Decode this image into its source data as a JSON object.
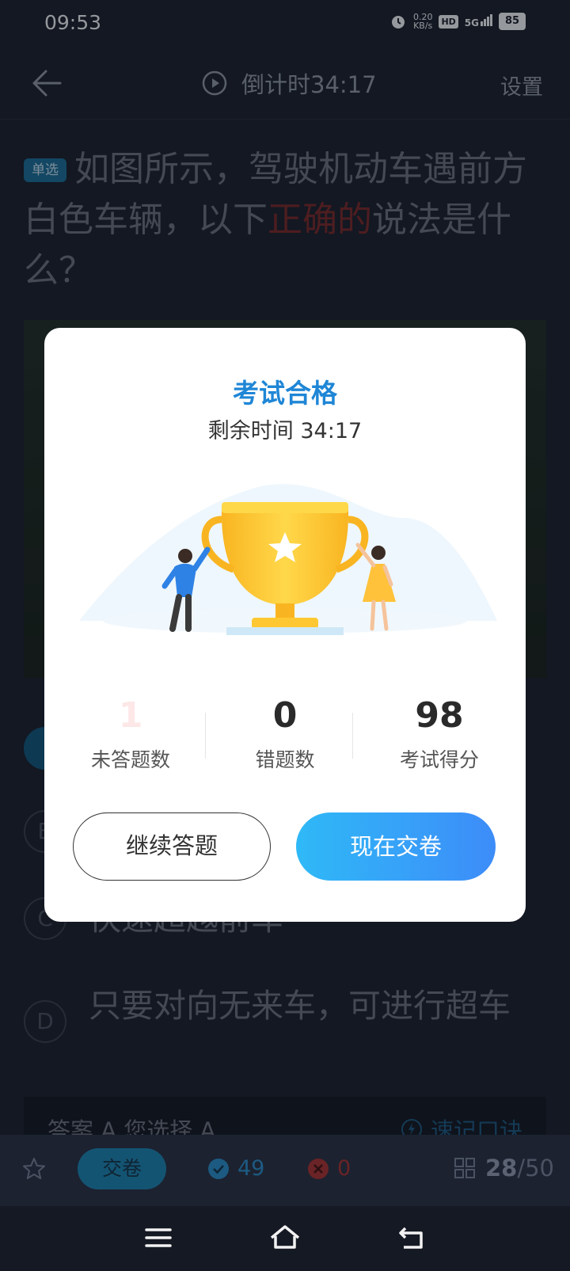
{
  "status_bar": {
    "time": "09:53",
    "speed_value": "0.20",
    "speed_unit": "KB/s",
    "hd": "HD",
    "network": "5G",
    "battery": "85"
  },
  "header": {
    "countdown": "倒计时34:17",
    "settings": "设置"
  },
  "question": {
    "type_tag": "单选",
    "text_before": "如图所示，驾驶机动车遇前方白色车辆，以下",
    "text_highlight": "正确的",
    "text_after": "说法是什么？"
  },
  "options": [
    {
      "letter": "B",
      "text": ""
    },
    {
      "letter": "C",
      "text": "快速超越前车"
    },
    {
      "letter": "D",
      "text": "只要对向无来车，可进行超车"
    }
  ],
  "answer_bar": {
    "answer_label": "答案",
    "answer_value": "A",
    "your_label": "您选择",
    "your_value": "A",
    "tip_label": "速记口诀"
  },
  "bottom_bar": {
    "submit": "交卷",
    "correct_count": "49",
    "wrong_count": "0",
    "current": "28",
    "total": "/50"
  },
  "modal": {
    "title": "考试合格",
    "remaining": "剩余时间 34:17",
    "stats": [
      {
        "value": "1",
        "label": "未答题数"
      },
      {
        "value": "0",
        "label": "错题数"
      },
      {
        "value": "98",
        "label": "考试得分"
      }
    ],
    "continue_button": "继续答题",
    "submit_button": "现在交卷"
  },
  "colors": {
    "accent_blue": "#1f86d6",
    "submit_gradient_start": "#2fb9f7",
    "submit_gradient_end": "#3d8cf8",
    "highlight_red": "#d33a3a"
  }
}
